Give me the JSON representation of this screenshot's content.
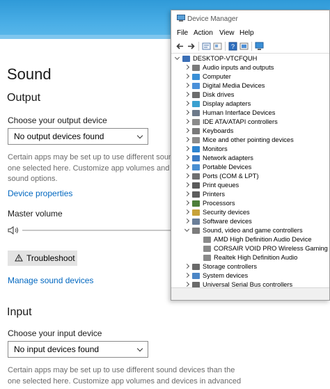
{
  "settings": {
    "title": "Sound",
    "output": {
      "heading": "Output",
      "choose_label": "Choose your output device",
      "selected": "No output devices found",
      "desc_line1": "Certain apps may be set up to use different sound",
      "desc_line2": "one selected here. Customize app volumes and d",
      "desc_line3": "sound options.",
      "properties_link": "Device properties",
      "master_volume_label": "Master volume",
      "troubleshoot_label": "Troubleshoot",
      "manage_link": "Manage sound devices"
    },
    "input": {
      "heading": "Input",
      "choose_label": "Choose your input device",
      "selected": "No input devices found",
      "desc_line1": "Certain apps may be set up to use different sound devices than the",
      "desc_line2": "one selected here. Customize app volumes and devices in advanced"
    }
  },
  "device_manager": {
    "window_title": "Device Manager",
    "menu": [
      "File",
      "Action",
      "View",
      "Help"
    ],
    "tree": [
      {
        "label": "DESKTOP-VTCFQUH",
        "level": 0,
        "expander": "open",
        "icon": "computer-icon",
        "color": "#3b6fb6"
      },
      {
        "label": "Audio inputs and outputs",
        "level": 1,
        "expander": "closed",
        "icon": "speaker-icon",
        "color": "#7b7b7b"
      },
      {
        "label": "Computer",
        "level": 1,
        "expander": "closed",
        "icon": "monitor-icon",
        "color": "#3a8fd6"
      },
      {
        "label": "Digital Media Devices",
        "level": 1,
        "expander": "closed",
        "icon": "media-icon",
        "color": "#4a90d9"
      },
      {
        "label": "Disk drives",
        "level": 1,
        "expander": "closed",
        "icon": "disk-icon",
        "color": "#6c6c6c"
      },
      {
        "label": "Display adapters",
        "level": 1,
        "expander": "closed",
        "icon": "display-adapter-icon",
        "color": "#3aa0d0"
      },
      {
        "label": "Human Interface Devices",
        "level": 1,
        "expander": "closed",
        "icon": "hid-icon",
        "color": "#6d7a8a"
      },
      {
        "label": "IDE ATA/ATAPI controllers",
        "level": 1,
        "expander": "closed",
        "icon": "ide-icon",
        "color": "#8a8a8a"
      },
      {
        "label": "Keyboards",
        "level": 1,
        "expander": "closed",
        "icon": "keyboard-icon",
        "color": "#7a7a7a"
      },
      {
        "label": "Mice and other pointing devices",
        "level": 1,
        "expander": "closed",
        "icon": "mouse-icon",
        "color": "#8c8c8c"
      },
      {
        "label": "Monitors",
        "level": 1,
        "expander": "closed",
        "icon": "monitor-icon",
        "color": "#2e84d0"
      },
      {
        "label": "Network adapters",
        "level": 1,
        "expander": "closed",
        "icon": "network-icon",
        "color": "#3b7bc4"
      },
      {
        "label": "Portable Devices",
        "level": 1,
        "expander": "closed",
        "icon": "portable-icon",
        "color": "#4a8fd2"
      },
      {
        "label": "Ports (COM & LPT)",
        "level": 1,
        "expander": "closed",
        "icon": "port-icon",
        "color": "#6f6f6f"
      },
      {
        "label": "Print queues",
        "level": 1,
        "expander": "closed",
        "icon": "printer-icon",
        "color": "#5b5b5b"
      },
      {
        "label": "Printers",
        "level": 1,
        "expander": "closed",
        "icon": "printer-icon",
        "color": "#5e5e5e"
      },
      {
        "label": "Processors",
        "level": 1,
        "expander": "closed",
        "icon": "processor-icon",
        "color": "#4d7f3a"
      },
      {
        "label": "Security devices",
        "level": 1,
        "expander": "closed",
        "icon": "security-icon",
        "color": "#c7a23a"
      },
      {
        "label": "Software devices",
        "level": 1,
        "expander": "closed",
        "icon": "software-icon",
        "color": "#6b7f99"
      },
      {
        "label": "Sound, video and game controllers",
        "level": 1,
        "expander": "open",
        "icon": "speaker-icon",
        "color": "#7c7c7c"
      },
      {
        "label": "AMD High Definition Audio Device",
        "level": 2,
        "expander": "none",
        "icon": "speaker-icon",
        "color": "#8a8a8a"
      },
      {
        "label": "CORSAIR VOID PRO Wireless Gaming Heads",
        "level": 2,
        "expander": "none",
        "icon": "speaker-icon",
        "color": "#8a8a8a"
      },
      {
        "label": "Realtek High Definition Audio",
        "level": 2,
        "expander": "none",
        "icon": "speaker-icon",
        "color": "#8a8a8a"
      },
      {
        "label": "Storage controllers",
        "level": 1,
        "expander": "closed",
        "icon": "storage-icon",
        "color": "#6a6a6a"
      },
      {
        "label": "System devices",
        "level": 1,
        "expander": "closed",
        "icon": "system-icon",
        "color": "#4b86c6"
      },
      {
        "label": "Universal Serial Bus controllers",
        "level": 1,
        "expander": "closed",
        "icon": "usb-icon",
        "color": "#6a6a6a"
      }
    ]
  }
}
